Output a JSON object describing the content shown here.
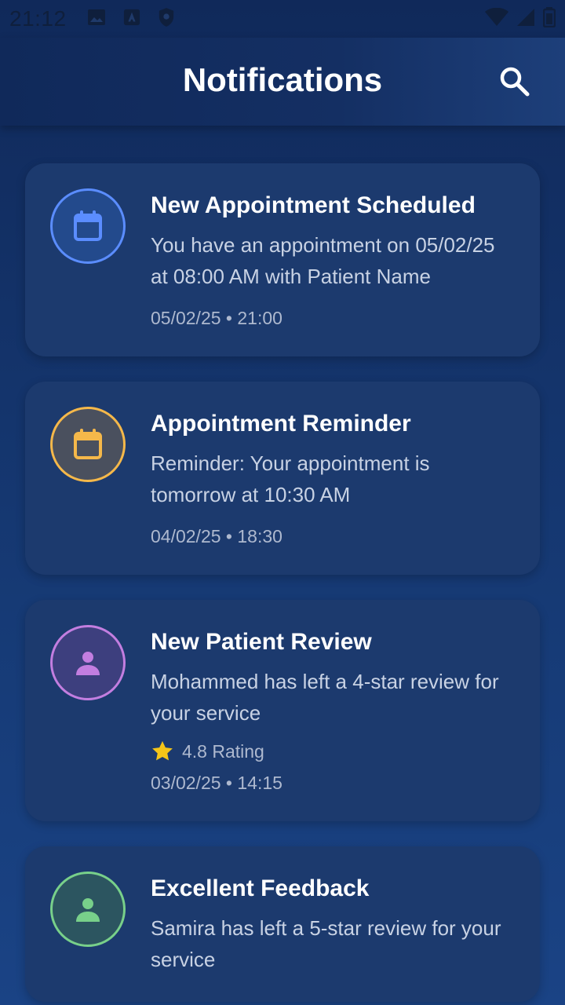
{
  "status_bar": {
    "time": "21:12",
    "left_icons": [
      "image-icon",
      "font-download-icon",
      "shield-icon"
    ],
    "right_icons": [
      "wifi-icon",
      "signal-icon",
      "battery-icon"
    ]
  },
  "header": {
    "title": "Notifications",
    "search_icon": "search-icon"
  },
  "notifications": [
    {
      "title": "New Appointment Scheduled",
      "body": "You have an appointment on 05/02/25 at 08:00 AM with Patient Name",
      "date": "05/02/25 • 21:00",
      "icon": "calendar-icon",
      "accent": "#5b8dff",
      "avatar_bg": "#234a8c"
    },
    {
      "title": "Appointment Reminder",
      "body": "Reminder: Your appointment is tomorrow at 10:30 AM",
      "date": "04/02/25 • 18:30",
      "icon": "calendar-icon",
      "accent": "#f5b84a",
      "avatar_bg": "#4a505e"
    },
    {
      "title": "New Patient Review",
      "body": "Mohammed has left a 4-star review for your service",
      "rating": "4.8 Rating",
      "date": "03/02/25 • 14:15",
      "icon": "person-icon",
      "accent": "#c37ee0",
      "avatar_bg": "#3d3f7e"
    },
    {
      "title": "Excellent Feedback",
      "body": "Samira has left a 5-star review for your service",
      "icon": "person-icon",
      "accent": "#78d08a",
      "avatar_bg": "#2c5560"
    }
  ],
  "colors": {
    "star": "#f5c518",
    "card_bg": "#1c3a6e"
  }
}
